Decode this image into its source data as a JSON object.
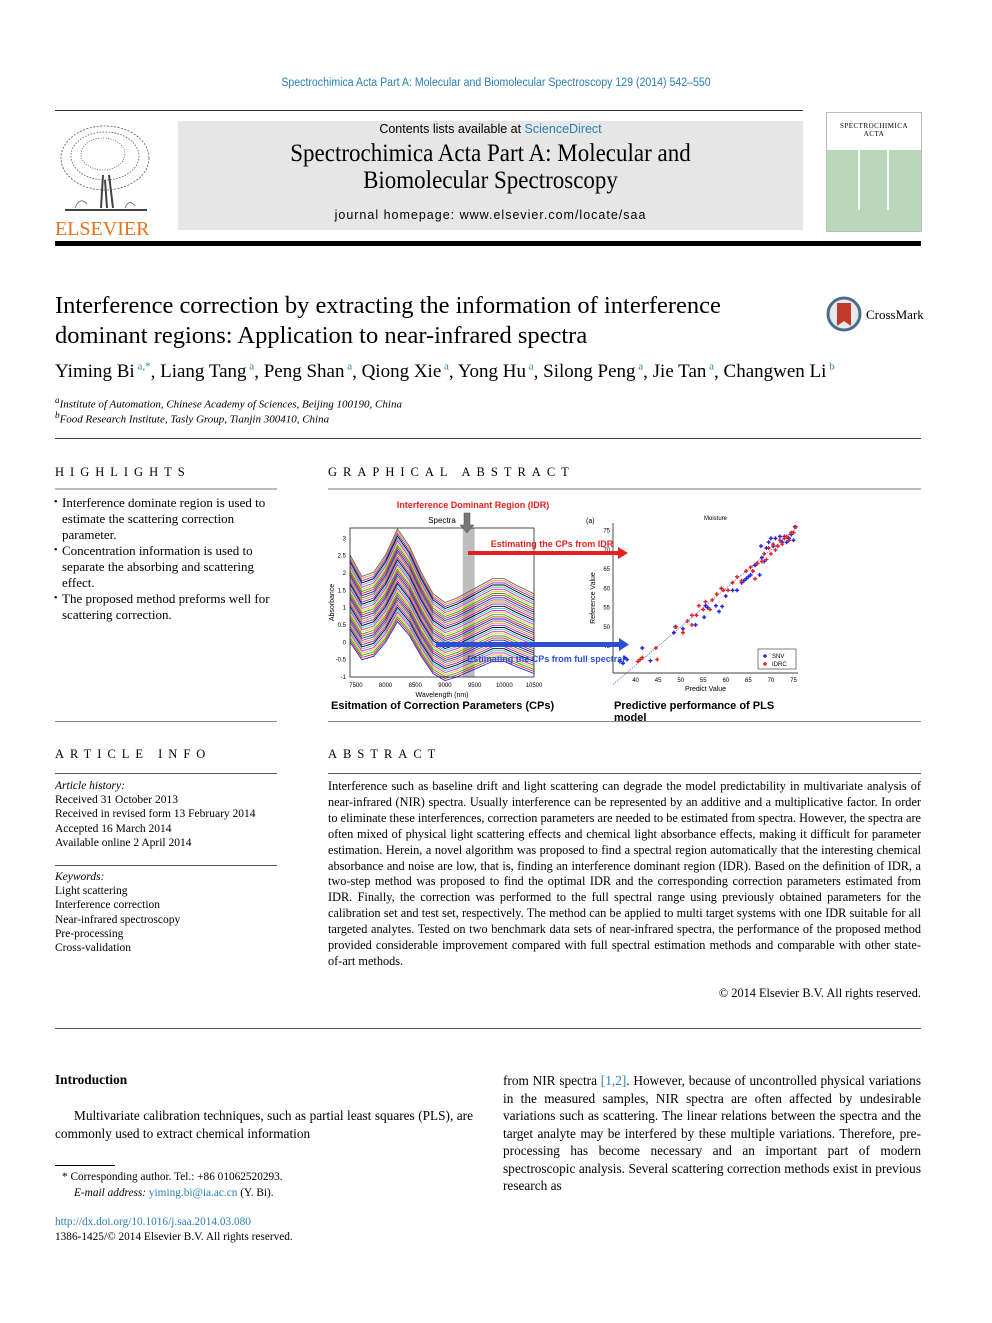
{
  "header": {
    "running_citation": "Spectrochimica Acta Part A: Molecular and Biomolecular Spectroscopy 129 (2014) 542–550",
    "contents_prefix": "Contents lists available at ",
    "contents_link": "ScienceDirect",
    "journal_title_line1": "Spectrochimica Acta Part A: Molecular and",
    "journal_title_line2": "Biomolecular Spectroscopy",
    "homepage": "journal homepage: www.elsevier.com/locate/saa",
    "publisher_logo_text": "ELSEVIER",
    "cover_title_line1": "SPECTROCHIMICA",
    "cover_title_line2": "ACTA",
    "crossmark_label": "CrossMark",
    "colors": {
      "link": "#2a7fb3",
      "elsevier_orange": "#e9711c",
      "cover_green": "#b9d7b9",
      "masthead_gray": "#e6e6e6"
    }
  },
  "article": {
    "title_line1": "Interference correction by extracting the information of interference",
    "title_line2": "dominant regions: Application to near-infrared spectra",
    "authors": [
      {
        "name": "Yiming Bi",
        "sup": "a,*"
      },
      {
        "name": "Liang Tang",
        "sup": "a"
      },
      {
        "name": "Peng Shan",
        "sup": "a"
      },
      {
        "name": "Qiong Xie",
        "sup": "a"
      },
      {
        "name": "Yong Hu",
        "sup": "a"
      },
      {
        "name": "Silong Peng",
        "sup": "a"
      },
      {
        "name": "Jie Tan",
        "sup": "a"
      },
      {
        "name": "Changwen Li",
        "sup": "b"
      }
    ],
    "affiliations": [
      {
        "mark": "a",
        "text": "Institute of Automation, Chinese Academy of Sciences, Beijing 100190, China"
      },
      {
        "mark": "b",
        "text": "Food Research Institute, Tasly Group, Tianjin 300410, China"
      }
    ]
  },
  "highlights": {
    "heading": "HIGHLIGHTS",
    "items": [
      "Interference dominate region is used to estimate the scattering correction parameter.",
      "Concentration information is used to separate the absorbing and scattering effect.",
      "The proposed method preforms well for scattering correction."
    ]
  },
  "graphical_abstract": {
    "heading": "GRAPHICAL ABSTRACT",
    "idr_label": "Interference Dominant Region (IDR)",
    "arrow_idr_label": "Estimating the CPs from IDR",
    "arrow_full_label": "Estimating the CPs from full spectral",
    "caption_left": "Esitmation of Correction Parameters (CPs)",
    "caption_right": "Predictive performance of PLS model"
  },
  "chart_data": [
    {
      "type": "line",
      "title": "Spectra",
      "xlabel": "Wavelength (nm)",
      "ylabel": "Absorbance",
      "x_ticks": [
        7500,
        8000,
        8500,
        9000,
        9500,
        10000,
        10500
      ],
      "y_ticks": [
        -1,
        -0.5,
        0,
        0.5,
        1,
        1.5,
        2,
        2.5,
        3
      ],
      "xlim": [
        7400,
        10500
      ],
      "ylim": [
        -1,
        3.3
      ],
      "idr_band_nm": [
        9300,
        9500
      ],
      "series_shape": {
        "x": [
          7400,
          7600,
          7800,
          8000,
          8200,
          8400,
          8600,
          8800,
          9000,
          9200,
          9400,
          9600,
          9800,
          10000,
          10200,
          10500
        ],
        "base": [
          1.3,
          0.8,
          0.9,
          1.3,
          1.9,
          1.5,
          0.9,
          0.4,
          0.2,
          0.3,
          0.45,
          0.6,
          0.75,
          0.75,
          0.6,
          0.4
        ]
      },
      "series_count": 40,
      "offset_range": [
        -1.3,
        0.9
      ]
    },
    {
      "type": "scatter",
      "panel_label": "(a)",
      "title": "Moisture",
      "xlabel": "Predict Value",
      "ylabel": "Reference Value",
      "x_ticks": [
        40,
        45,
        50,
        55,
        60,
        65,
        70,
        75
      ],
      "y_ticks": [
        45,
        50,
        55,
        60,
        65,
        70,
        75
      ],
      "xlim": [
        35,
        76
      ],
      "ylim": [
        38,
        77
      ],
      "legend": {
        "position": "bottom-right",
        "entries": [
          "SNV",
          "IDRC"
        ]
      },
      "series": [
        {
          "name": "SNV",
          "color": "#1f1fe6",
          "points": [
            [
              36.5,
              41
            ],
            [
              37.2,
              40.5
            ],
            [
              37.6,
              42
            ],
            [
              38.1,
              41.5
            ],
            [
              41.5,
              44.5
            ],
            [
              43.3,
              41.2
            ],
            [
              48.5,
              48.5
            ],
            [
              48.8,
              50
            ],
            [
              50.5,
              49.5
            ],
            [
              53.3,
              50.5
            ],
            [
              55.2,
              52.5
            ],
            [
              55.5,
              55.5
            ],
            [
              56.0,
              55
            ],
            [
              57.8,
              55.5
            ],
            [
              58.5,
              54
            ],
            [
              59.2,
              55.3
            ],
            [
              60,
              58
            ],
            [
              61.5,
              59.5
            ],
            [
              62.5,
              59.5
            ],
            [
              63.5,
              61.5
            ],
            [
              64,
              62
            ],
            [
              64.5,
              62.5
            ],
            [
              65,
              63
            ],
            [
              65.5,
              63.5
            ],
            [
              66,
              64.5
            ],
            [
              66.5,
              66
            ],
            [
              67,
              66.5
            ],
            [
              67.5,
              63.5
            ],
            [
              67.8,
              71
            ],
            [
              68,
              68
            ],
            [
              68.5,
              67
            ],
            [
              69,
              70.5
            ],
            [
              69.5,
              72
            ],
            [
              70,
              73
            ],
            [
              70.5,
              71
            ],
            [
              71,
              73
            ],
            [
              71.5,
              71
            ],
            [
              72,
              73.5
            ],
            [
              72.5,
              72
            ],
            [
              73,
              73.5
            ],
            [
              73.5,
              72
            ],
            [
              74,
              73
            ],
            [
              74.5,
              74
            ],
            [
              75,
              72.5
            ],
            [
              75.3,
              76
            ]
          ]
        },
        {
          "name": "IDRC",
          "color": "#e61f1f",
          "points": [
            [
              40.5,
              41
            ],
            [
              41,
              41.5
            ],
            [
              41.5,
              42
            ],
            [
              44.5,
              44.5
            ],
            [
              44.8,
              41.5
            ],
            [
              49,
              50
            ],
            [
              50.5,
              48.5
            ],
            [
              51.5,
              51.5
            ],
            [
              52.5,
              53
            ],
            [
              52.5,
              50.5
            ],
            [
              53.5,
              53
            ],
            [
              54,
              55.5
            ],
            [
              55,
              54.5
            ],
            [
              55.5,
              56.5
            ],
            [
              56.5,
              54.5
            ],
            [
              57,
              57
            ],
            [
              58,
              58.5
            ],
            [
              59,
              60
            ],
            [
              59.5,
              59.5
            ],
            [
              60.5,
              59.5
            ],
            [
              61.5,
              61.5
            ],
            [
              62.5,
              63
            ],
            [
              63.5,
              62
            ],
            [
              64.5,
              64.5
            ],
            [
              65.5,
              65.5
            ],
            [
              66,
              64.5
            ],
            [
              66.5,
              62.5
            ],
            [
              67,
              66.5
            ],
            [
              68,
              67
            ],
            [
              68.5,
              69
            ],
            [
              69,
              67.5
            ],
            [
              69.5,
              70.5
            ],
            [
              70,
              69
            ],
            [
              70.5,
              71.5
            ],
            [
              71,
              70
            ],
            [
              71.5,
              71
            ],
            [
              72,
              72.5
            ],
            [
              72.5,
              71.5
            ],
            [
              73,
              73
            ],
            [
              73.5,
              73.5
            ],
            [
              74,
              72.5
            ],
            [
              74.5,
              74.5
            ],
            [
              75,
              74.5
            ],
            [
              75.5,
              76
            ]
          ]
        }
      ]
    }
  ],
  "article_info": {
    "heading": "ARTICLE INFO",
    "history_label": "Article history:",
    "history": [
      "Received 31 October 2013",
      "Received in revised form 13 February 2014",
      "Accepted 16 March 2014",
      "Available online 2 April 2014"
    ],
    "keywords_label": "Keywords:",
    "keywords": [
      "Light scattering",
      "Interference correction",
      "Near-infrared spectroscopy",
      "Pre-processing",
      "Cross-validation"
    ]
  },
  "abstract": {
    "heading": "ABSTRACT",
    "text": "Interference such as baseline drift and light scattering can degrade the model predictability in multivariate analysis of near-infrared (NIR) spectra. Usually interference can be represented by an additive and a multiplicative factor. In order to eliminate these interferences, correction parameters are needed to be estimated from spectra. However, the spectra are often mixed of physical light scattering effects and chemical light absorbance effects, making it difficult for parameter estimation. Herein, a novel algorithm was proposed to find a spectral region automatically that the interesting chemical absorbance and noise are low, that is, finding an interference dominant region (IDR). Based on the definition of IDR, a two-step method was proposed to find the optimal IDR and the corresponding correction parameters estimated from IDR. Finally, the correction was performed to the full spectral range using previously obtained parameters for the calibration set and test set, respectively. The method can be applied to multi target systems with one IDR suitable for all targeted analytes. Tested on two benchmark data sets of near-infrared spectra, the performance of the proposed method provided considerable improvement compared with full spectral estimation methods and comparable with other state-of-art methods.",
    "copyright": "© 2014 Elsevier B.V. All rights reserved."
  },
  "introduction": {
    "heading": "Introduction",
    "left_text": "Multivariate calibration techniques, such as partial least squares (PLS), are commonly used to extract chemical information",
    "right_prefix": "from NIR spectra ",
    "right_cite": "[1,2]",
    "right_text": ". However, because of uncontrolled physical variations in the measured samples, NIR spectra are often affected by undesirable variations such as scattering. The linear relations between the spectra and the target analyte may be interfered by these multiple variations. Therefore, pre-processing has become necessary and an important part of modern spectroscopic analysis. Several scattering correction methods exist in previous research as"
  },
  "footnotes": {
    "corresponding": "* Corresponding author. Tel.: +86 01062520293.",
    "email_label": "E-mail address: ",
    "email": "yiming.bi@ia.ac.cn",
    "email_suffix": " (Y. Bi).",
    "doi": "http://dx.doi.org/10.1016/j.saa.2014.03.080",
    "issn": "1386-1425/© 2014 Elsevier B.V. All rights reserved."
  }
}
